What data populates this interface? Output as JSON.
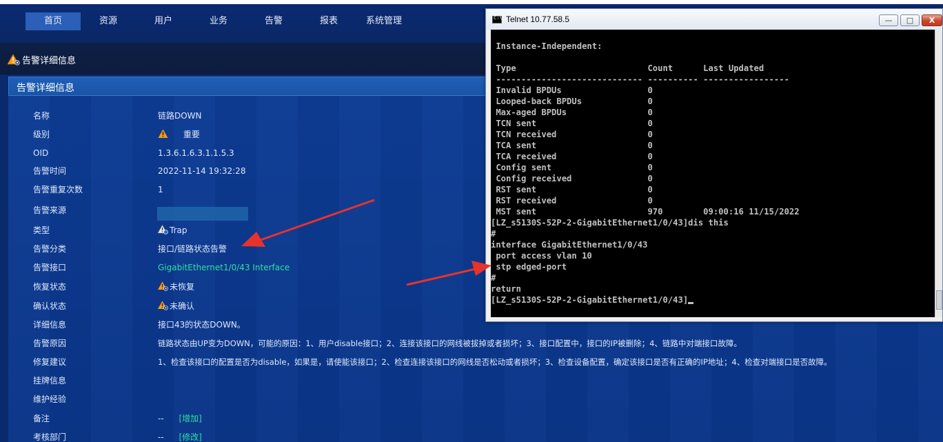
{
  "nav": {
    "items": [
      "首页",
      "资源",
      "用户",
      "业务",
      "告警",
      "报表",
      "系统管理"
    ],
    "active_index": 0
  },
  "breadcrumb": {
    "title": "告警详细信息"
  },
  "panel": {
    "title": "告警详细信息",
    "rows": [
      {
        "label": "名称",
        "value": "链路DOWN"
      },
      {
        "label": "级别",
        "value": "重要",
        "icon": "warning-icon"
      },
      {
        "label": "OID",
        "value": "1.3.6.1.6.3.1.1.5.3"
      },
      {
        "label": "告警时间",
        "value": "2022-11-14 19:32:28"
      },
      {
        "label": "告警重复次数",
        "value": "1"
      },
      {
        "label": "告警来源",
        "value": ""
      },
      {
        "label": "类型",
        "value": "Trap",
        "icon": "trap-icon"
      },
      {
        "label": "告警分类",
        "value": "接口/链路状态告警"
      },
      {
        "label": "告警接口",
        "value": "GigabitEthernet1/0/43 Interface",
        "link": true
      },
      {
        "label": "恢复状态",
        "value": "未恢复",
        "icon": "warning-eye-icon"
      },
      {
        "label": "确认状态",
        "value": "未确认",
        "icon": "warning-eye-icon"
      },
      {
        "label": "详细信息",
        "value": "接口43的状态DOWN。"
      },
      {
        "label": "告警原因",
        "value": "链路状态由UP变为DOWN，可能的原因：1、用户disable接口；2、连接该接口的网线被拔掉或者损坏；3、接口配置中，接口的IP被删除；4、链路中对端接口故障。"
      },
      {
        "label": "修复建议",
        "value": "1、检查该接口的配置是否为disable，如果是，请使能该接口；2、检查连接该接口的网线是否松动或者损坏；3、检查设备配置，确定该接口是否有正确的IP地址；4、检查对端接口是否故障。"
      },
      {
        "label": "挂牌信息",
        "value": ""
      },
      {
        "label": "维护经验",
        "value": ""
      },
      {
        "label": "备注",
        "value": "--",
        "action": "[增加]"
      },
      {
        "label": "考核部门",
        "value": "--",
        "action": "[修改]"
      }
    ]
  },
  "telnet": {
    "title": "Telnet 10.77.58.5",
    "buttons": {
      "minimize": "—",
      "maximize": "□",
      "close": "X"
    },
    "lines": [
      "",
      " Instance-Independent:",
      "",
      " Type                          Count      Last Updated",
      " ----------------------------- ---------- -----------------",
      " Invalid BPDUs                 0",
      " Looped-back BPDUs             0",
      " Max-aged BPDUs                0",
      " TCN sent                      0",
      " TCN received                  0",
      " TCA sent                      0",
      " TCA received                  0",
      " Config sent                   0",
      " Config received               0",
      " RST sent                      0",
      " RST received                  0",
      " MST sent                      970        09:00:16 11/15/2022",
      "[LZ_s5130S-52P-2-GigabitEthernet1/0/43]dis this",
      "#",
      "interface GigabitEthernet1/0/43",
      " port access vlan 10",
      " stp edged-port",
      "#",
      "return",
      "[LZ_s5130S-52P-2-GigabitEthernet1/0/43]"
    ]
  },
  "colors": {
    "accent": "#2b5fb8",
    "link": "#2ee0a0",
    "arrow": "#e8332a",
    "warning": "#f59a1b"
  }
}
